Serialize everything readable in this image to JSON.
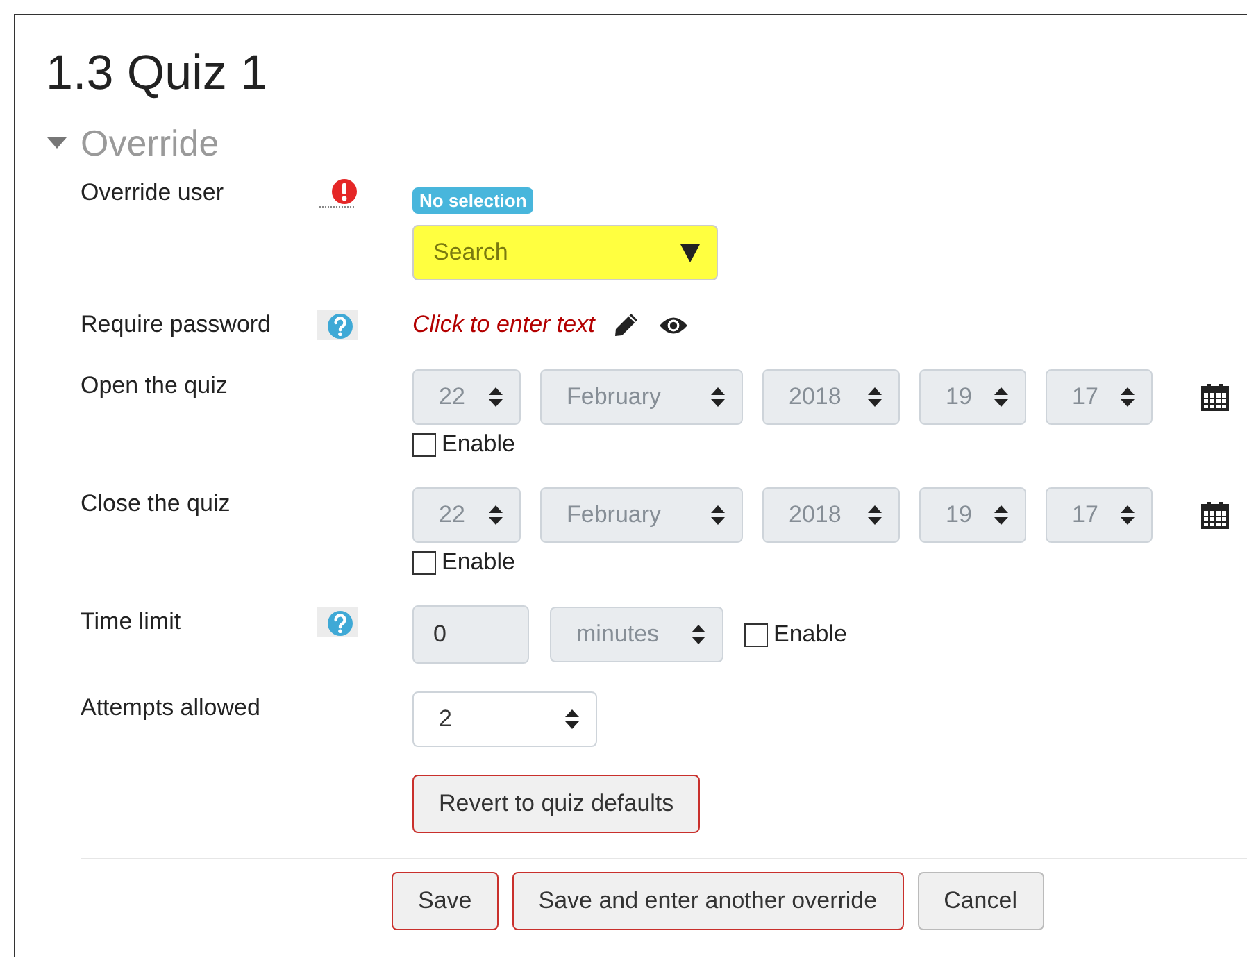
{
  "heading": "1.3 Quiz 1",
  "section": {
    "title": "Override",
    "expanded": true
  },
  "fields": [
    {
      "kind": "user",
      "label": "Override user",
      "badge": "No selection",
      "value": "Search",
      "highlighted": true
    },
    {
      "kind": "password",
      "label": "Require password",
      "value": "Click to enter text"
    },
    {
      "kind": "datetime",
      "label": "Open the quiz",
      "selects": [
        "22",
        "February",
        "2018",
        "19",
        "17"
      ],
      "enabled": false,
      "checkbox_label": "Enable"
    },
    {
      "kind": "datetime",
      "label": "Close the quiz",
      "selects": [
        "22",
        "February",
        "2018",
        "19",
        "17"
      ],
      "enabled": false,
      "checkbox_label": "Enable"
    },
    {
      "kind": "duration",
      "label": "Time limit",
      "value": "0",
      "unit": "minutes",
      "enabled": false,
      "checkbox_label": "Enable"
    },
    {
      "kind": "select",
      "label": "Attempts allowed",
      "value": "2"
    }
  ],
  "revert_button": "Revert to quiz defaults",
  "buttons": [
    {
      "label": "Save",
      "kind": "primary"
    },
    {
      "label": "Save and enter another override",
      "kind": "primary"
    },
    {
      "label": "Cancel",
      "kind": "secondary"
    }
  ]
}
